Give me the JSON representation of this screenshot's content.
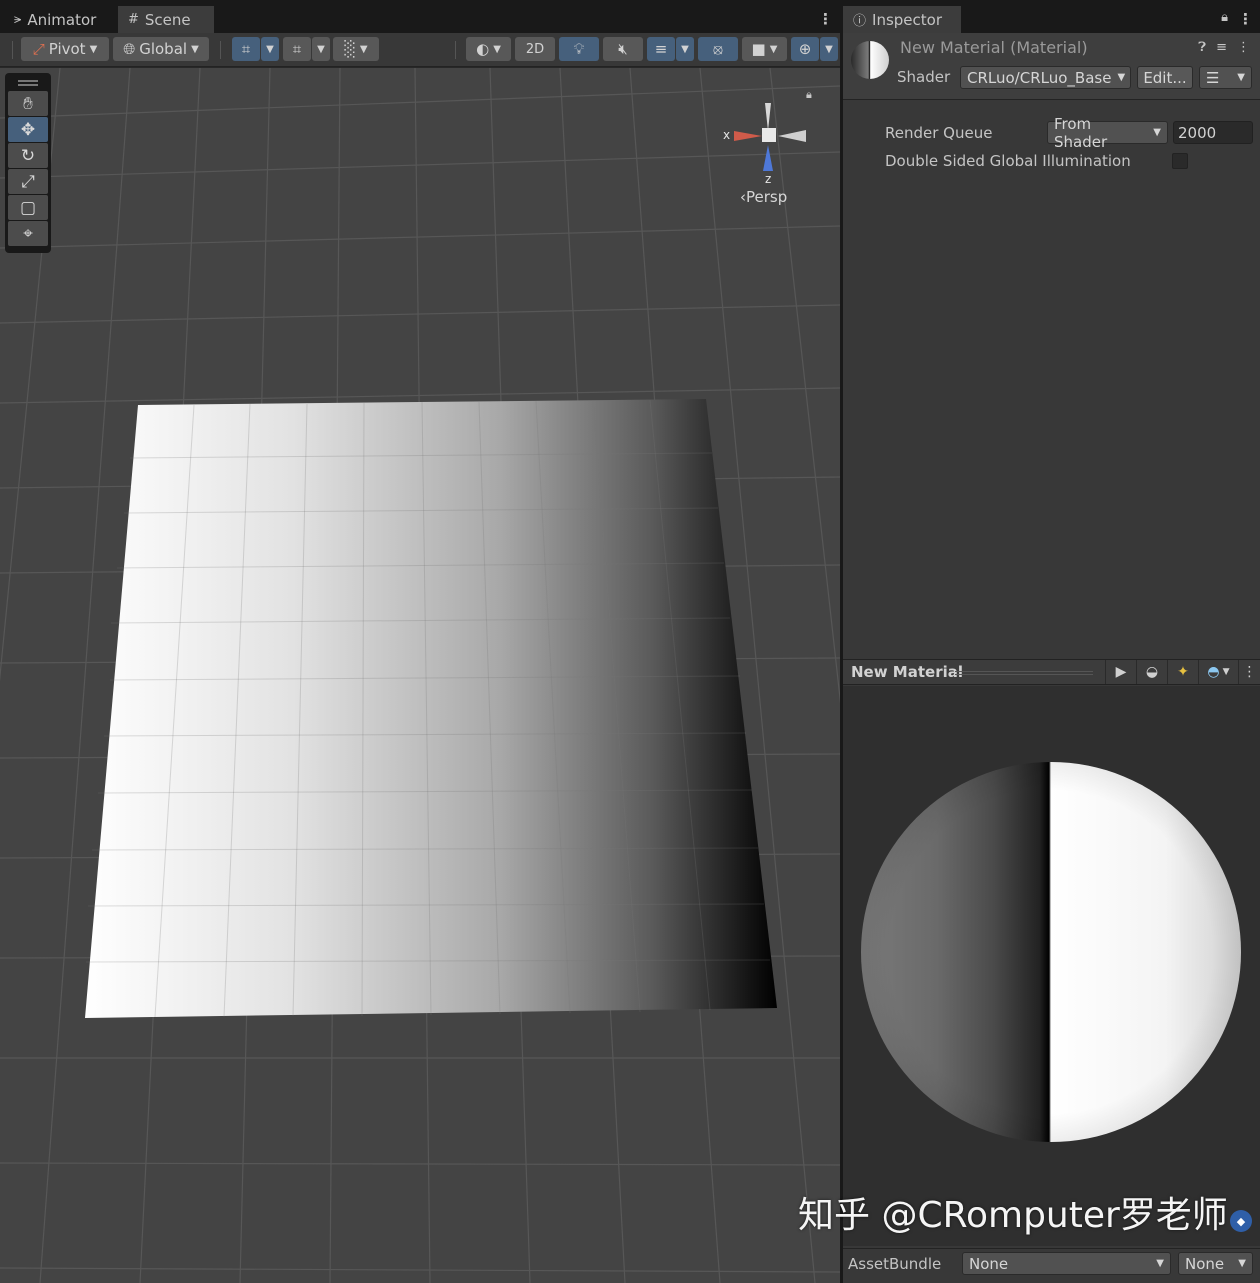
{
  "scene_window": {
    "tabs": [
      {
        "label": "Animator",
        "icon": "animator-icon"
      },
      {
        "label": "Scene",
        "icon": "grid-icon"
      }
    ],
    "toolbar": {
      "pivot_label": "Pivot",
      "global_label": "Global",
      "mode_2d_label": "2D"
    },
    "gizmo": {
      "x_label": "x",
      "z_label": "z",
      "projection_label": "Persp"
    }
  },
  "inspector": {
    "tab_label": "Inspector",
    "material_title": "New Material (Material)",
    "shader_label": "Shader",
    "shader_value": "CRLuo/CRLuo_Base",
    "edit_button": "Edit...",
    "properties": {
      "render_queue_label": "Render Queue",
      "render_queue_mode": "From Shader",
      "render_queue_value": "2000",
      "double_sided_gi_label": "Double Sided Global Illumination",
      "double_sided_gi_checked": false
    },
    "preview": {
      "title": "New Material"
    },
    "asset_bundle": {
      "label": "AssetBundle",
      "name_value": "None",
      "variant_value": "None"
    }
  },
  "watermark": "知乎 @CRomputer罗老师",
  "colors": {
    "accent_blue": "#46607c",
    "panel_bg": "#383838",
    "viewport_bg": "#444444"
  }
}
